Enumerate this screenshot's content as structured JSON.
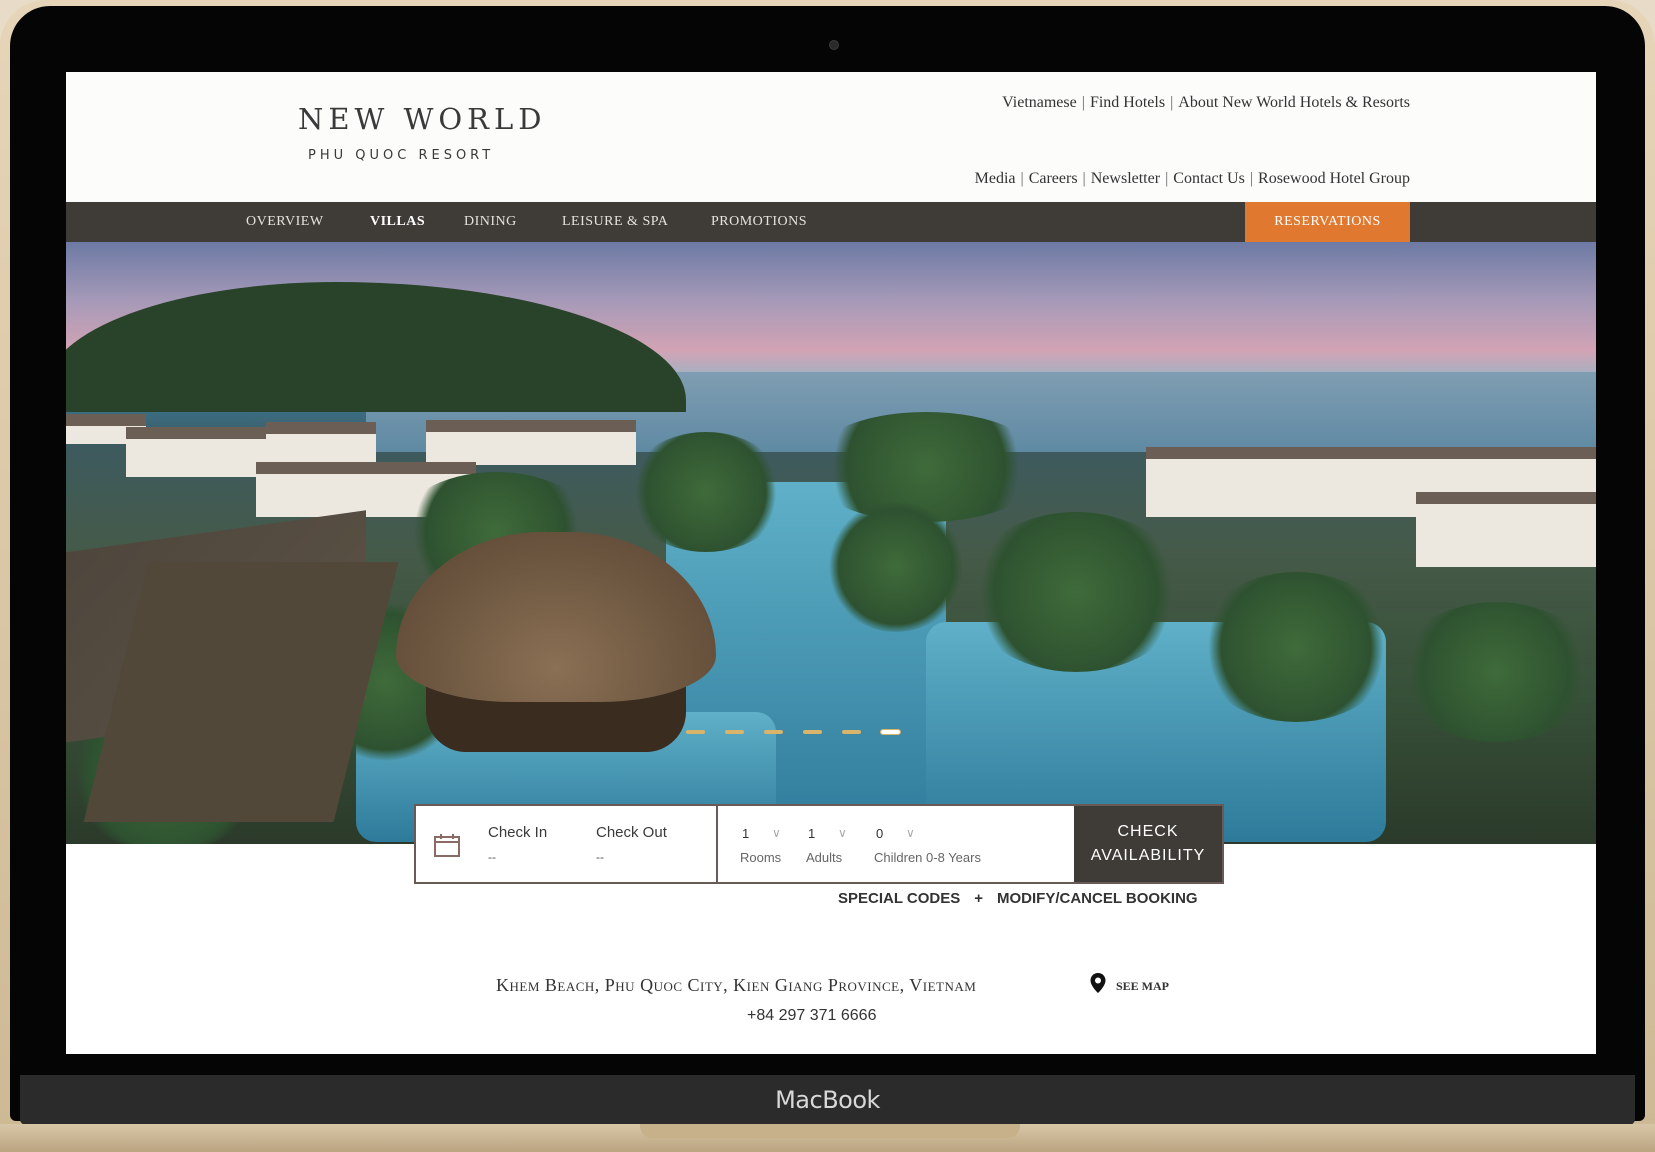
{
  "device": {
    "brand": "MacBook"
  },
  "logo": {
    "main": "NEW WORLD",
    "sub": "PHU QUOC RESORT"
  },
  "top_links_row1": [
    "Vietnamese",
    "Find Hotels",
    "About New World Hotels & Resorts"
  ],
  "top_links_row2": [
    "Media",
    "Careers",
    "Newsletter",
    "Contact Us",
    "Rosewood Hotel Group"
  ],
  "nav": {
    "items": [
      "OVERVIEW",
      "VILLAS",
      "DINING",
      "LEISURE & SPA",
      "PROMOTIONS"
    ],
    "active": "VILLAS",
    "reservations": "RESERVATIONS"
  },
  "carousel": {
    "slide_count": 6,
    "active_index": 5
  },
  "booking": {
    "check_in_label": "Check In",
    "check_in_value": "--",
    "check_out_label": "Check Out",
    "check_out_value": "--",
    "rooms_value": "1",
    "rooms_label": "Rooms",
    "adults_value": "1",
    "adults_label": "Adults",
    "children_value": "0",
    "children_label": "Children 0-8 Years",
    "button_line1": "CHECK",
    "button_line2": "AVAILABILITY"
  },
  "links": {
    "special_codes": "SPECIAL CODES",
    "modify": "MODIFY/CANCEL BOOKING"
  },
  "footer": {
    "address": "Khem Beach, Phu Quoc City, Kien Giang Province, Vietnam",
    "see_map": "SEE MAP",
    "phone": "+84 297 371 6666"
  },
  "colors": {
    "nav_bg": "#3f3c38",
    "accent": "#e0782f",
    "dot": "#d8b56a"
  }
}
